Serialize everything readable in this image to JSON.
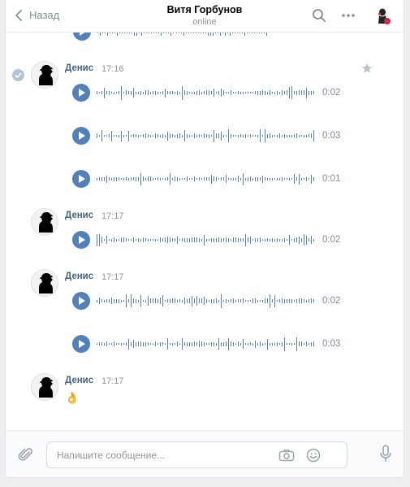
{
  "header": {
    "back_label": "Назад",
    "title": "Витя Горбунов",
    "status": "online"
  },
  "messages": [
    {
      "author": "Денис",
      "time": "17:16",
      "voices": [
        {
          "duration": "0:02"
        },
        {
          "duration": "0:03"
        },
        {
          "duration": "0:01"
        }
      ]
    },
    {
      "author": "Денис",
      "time": "17:17",
      "voices": [
        {
          "duration": "0:02"
        }
      ]
    },
    {
      "author": "Денис",
      "time": "17:17",
      "voices": [
        {
          "duration": "0:02"
        },
        {
          "duration": "0:03"
        }
      ]
    },
    {
      "author": "Денис",
      "time": "17:17",
      "emoji": "👌"
    }
  ],
  "composer": {
    "placeholder": "Напишите сообщение..."
  },
  "colors": {
    "accent": "#5181b8",
    "author": "#42648b",
    "muted": "#939393"
  }
}
